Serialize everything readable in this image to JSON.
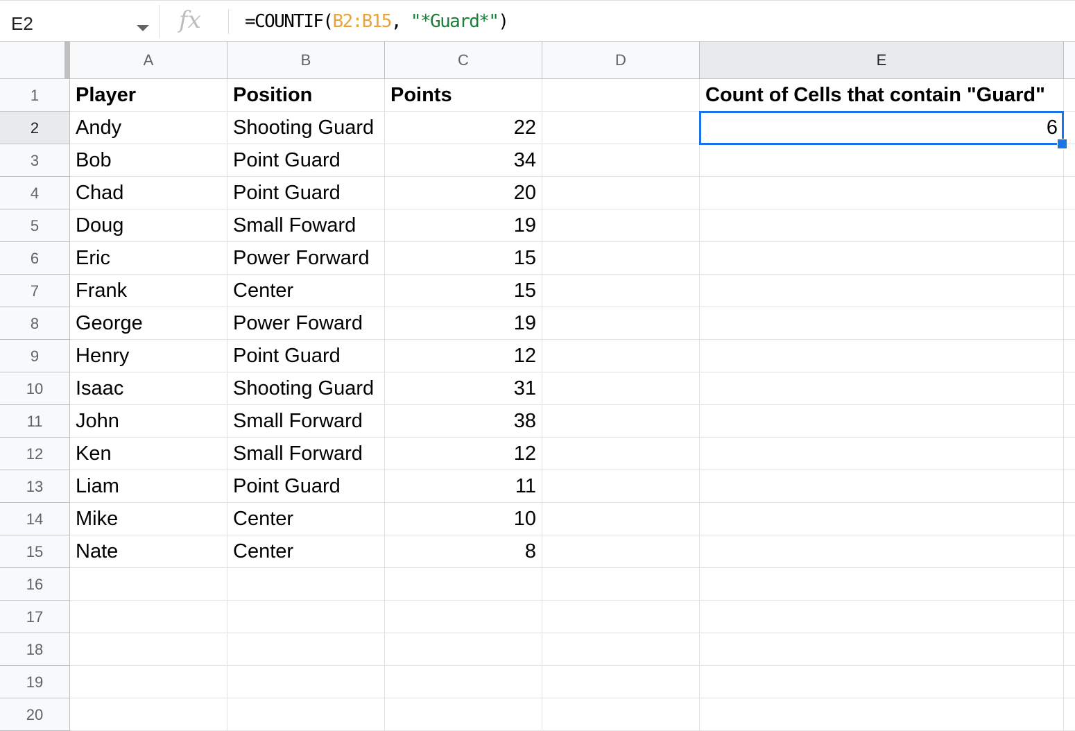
{
  "name_box": "E2",
  "formula_bar": {
    "prefix": "=COUNTIF(",
    "range": "B2:B15",
    "sep": ", ",
    "criteria": "\"*Guard*\"",
    "suffix": ")"
  },
  "columns": [
    "A",
    "B",
    "C",
    "D",
    "E"
  ],
  "row_numbers": [
    "1",
    "2",
    "3",
    "4",
    "5",
    "6",
    "7",
    "8",
    "9",
    "10",
    "11",
    "12",
    "13",
    "14",
    "15",
    "16",
    "17",
    "18",
    "19",
    "20"
  ],
  "header": {
    "player": "Player",
    "position": "Position",
    "points": "Points",
    "result_label": "Count of Cells that contain \"Guard\""
  },
  "rows": [
    {
      "player": "Andy",
      "position": "Shooting Guard",
      "points": "22"
    },
    {
      "player": "Bob",
      "position": "Point Guard",
      "points": "34"
    },
    {
      "player": "Chad",
      "position": "Point Guard",
      "points": "20"
    },
    {
      "player": "Doug",
      "position": "Small Foward",
      "points": "19"
    },
    {
      "player": "Eric",
      "position": "Power Forward",
      "points": "15"
    },
    {
      "player": "Frank",
      "position": "Center",
      "points": "15"
    },
    {
      "player": "George",
      "position": "Power Foward",
      "points": "19"
    },
    {
      "player": "Henry",
      "position": "Point Guard",
      "points": "12"
    },
    {
      "player": "Isaac",
      "position": "Shooting Guard",
      "points": "31"
    },
    {
      "player": "John",
      "position": "Small Forward",
      "points": "38"
    },
    {
      "player": "Ken",
      "position": "Small Forward",
      "points": "12"
    },
    {
      "player": "Liam",
      "position": "Point Guard",
      "points": "11"
    },
    {
      "player": "Mike",
      "position": "Center",
      "points": "10"
    },
    {
      "player": "Nate",
      "position": "Center",
      "points": "8"
    }
  ],
  "result_value": "6",
  "selection_color": "#1a73e8"
}
